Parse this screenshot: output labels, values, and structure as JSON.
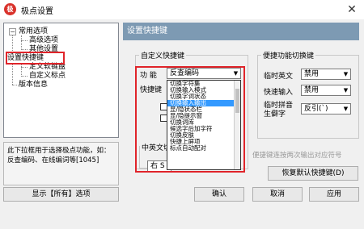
{
  "window": {
    "title": "极点设置",
    "icon_glyph": "极",
    "close_glyph": "✕"
  },
  "tree": {
    "items": [
      {
        "label": "常用选项"
      },
      {
        "label": "高级选项"
      },
      {
        "label": "其他设置"
      },
      {
        "label": "设置快捷键"
      },
      {
        "label": "定义软键盘"
      },
      {
        "label": "自定义标点"
      },
      {
        "label": "版本信息"
      }
    ]
  },
  "description": "此下拉框用于选择极点功能，如：反查编码、在线编词等[1045]",
  "show_all_button": "显示【所有】选项",
  "panel": {
    "header": "设置快捷键"
  },
  "custom_group": {
    "title": "自定义快捷键",
    "func_label": "功  能",
    "func_value": "反查编码",
    "key_label": "快捷键",
    "cn_en_label": "中英文切",
    "cn_en_value": "右 S"
  },
  "dropdown": {
    "items": [
      "切换字符集",
      "切换输入模式",
      "切换字词状态",
      "切换输入输出",
      "显/隐状态栏",
      "显/隐提示窗",
      "切换词库",
      "候选字后加字符",
      "切换皮肤",
      "快捷上屏项",
      "标点自动配对"
    ],
    "selected_index": 3
  },
  "switch_group": {
    "title": "便捷功能切换键",
    "rows": [
      {
        "label": "临时英文",
        "value": "禁用"
      },
      {
        "label": "快速输入",
        "value": "禁用"
      },
      {
        "label": "临时拼音\n生僻字",
        "value": "反引(`)"
      }
    ]
  },
  "hint": "便捷键连按两次输出对应符号",
  "restore_button": "恢复默认快捷键(D)",
  "buttons": {
    "ok": "确认",
    "cancel": "取消",
    "apply": "应用"
  }
}
